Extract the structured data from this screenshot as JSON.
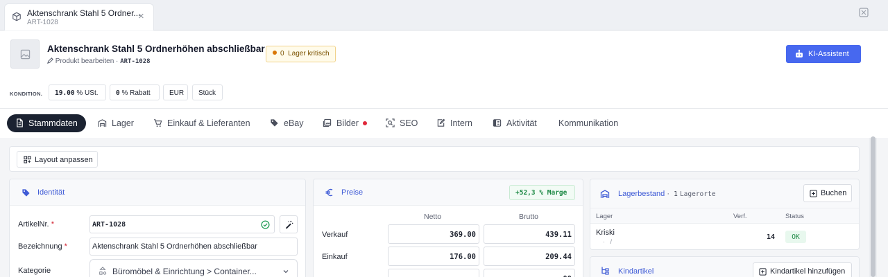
{
  "doc_tab": {
    "title": "Aktenschrank Stahl 5 Ordner...",
    "subtitle": "ART-1028",
    "icon": "box-icon",
    "close": "×"
  },
  "header": {
    "title": "Aktenschrank Stahl 5 Ordnerhöhen abschließbar",
    "edit_label": "Produkt bearbeiten ·",
    "art_nr": "ART-1028",
    "stock_badge": {
      "count": "0",
      "label": "Lager kritisch",
      "color": "#d97706"
    },
    "ai_button": "KI-Assistent",
    "accent": "#4768ef"
  },
  "kondition": {
    "label": "KONDITION.",
    "chips": [
      {
        "value": "19.00",
        "unit": "% USt."
      },
      {
        "value": "0",
        "unit": "% Rabatt"
      },
      {
        "value": "",
        "unit": "EUR"
      },
      {
        "value": "",
        "unit": "Stück"
      }
    ]
  },
  "nav": {
    "tabs": [
      {
        "label": "Stammdaten",
        "icon": "document-icon",
        "active": true
      },
      {
        "label": "Lager",
        "icon": "warehouse-icon"
      },
      {
        "label": "Einkauf & Lieferanten",
        "icon": "cart-icon"
      },
      {
        "label": "eBay",
        "icon": "tag-icon"
      },
      {
        "label": "Bilder",
        "icon": "images-icon",
        "dot": true
      },
      {
        "label": "SEO",
        "icon": "scan-search-icon"
      },
      {
        "label": "Intern",
        "icon": "note-edit-icon"
      },
      {
        "label": "Aktivität",
        "icon": "activity-icon"
      },
      {
        "label": "Kommunikation",
        "icon": ""
      }
    ]
  },
  "layout_button": "Layout anpassen",
  "identitaet": {
    "title": "Identität",
    "fields": [
      {
        "label": "ArtikelNr.",
        "required": "*",
        "value": "ART-1028"
      },
      {
        "label": "Bezeichnung",
        "required": "*",
        "value": "Aktenschrank Stahl 5 Ordnerhöhen abschließbar"
      },
      {
        "label": "Kategorie",
        "value": "Büromöbel & Einrichtung > Container..."
      }
    ]
  },
  "preise": {
    "title": "Preise",
    "marge": "+52,3 % Marge",
    "columns": [
      "Netto",
      "Brutto"
    ],
    "rows": [
      {
        "label": "Verkauf",
        "netto": "369.00",
        "brutto": "439.11"
      },
      {
        "label": "Einkauf",
        "netto": "176.00",
        "brutto": "209.44"
      },
      {
        "label": "",
        "netto": "",
        "brutto": "...00"
      }
    ]
  },
  "lagerbestand": {
    "title": "Lagerbestand",
    "sep": "·",
    "count": "1",
    "count_label": "Lagerorte",
    "book_button": "Buchen",
    "columns": [
      "Lager",
      "Verf.",
      "Status"
    ],
    "rows": [
      {
        "lager": "Kriski",
        "sub": "·   /",
        "verf": "14",
        "status": "OK"
      }
    ]
  },
  "kindartikel": {
    "title": "Kindartikel",
    "add_button": "Kindartikel hinzufügen"
  }
}
